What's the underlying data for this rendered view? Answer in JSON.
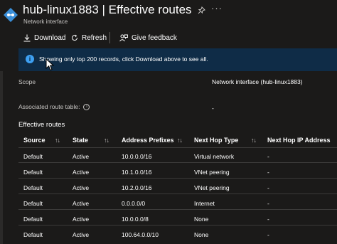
{
  "header": {
    "title": "hub-linux1883 | Effective routes",
    "subtitle": "Network interface",
    "more_label": "···"
  },
  "toolbar": {
    "download_label": "Download",
    "refresh_label": "Refresh",
    "feedback_label": "Give feedback"
  },
  "banner": {
    "text": "Showing only top 200 records, click Download above to see all."
  },
  "properties": {
    "scope_label": "Scope",
    "scope_value": "Network interface (hub-linux1883)",
    "route_table_label": "Associated route table:",
    "route_table_value": "-"
  },
  "section_title": "Effective routes",
  "table": {
    "columns": [
      "Source",
      "State",
      "Address Prefixes",
      "Next Hop Type",
      "Next Hop IP Address"
    ],
    "rows": [
      [
        "Default",
        "Active",
        "10.0.0.0/16",
        "Virtual network",
        "-"
      ],
      [
        "Default",
        "Active",
        "10.1.0.0/16",
        "VNet peering",
        "-"
      ],
      [
        "Default",
        "Active",
        "10.2.0.0/16",
        "VNet peering",
        "-"
      ],
      [
        "Default",
        "Active",
        "0.0.0.0/0",
        "Internet",
        "-"
      ],
      [
        "Default",
        "Active",
        "10.0.0.0/8",
        "None",
        "-"
      ],
      [
        "Default",
        "Active",
        "100.64.0.0/10",
        "None",
        "-"
      ]
    ]
  },
  "colors": {
    "background": "#1b1a19",
    "banner": "#0f2c47",
    "accent": "#3ea0f2",
    "text": "#ffffff",
    "muted": "#c8c6c4"
  }
}
